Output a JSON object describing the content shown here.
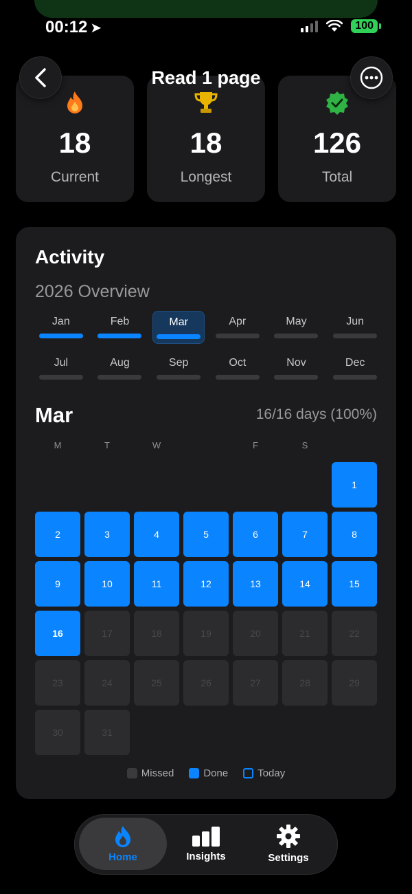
{
  "status_bar": {
    "time": "00:12",
    "battery": "100"
  },
  "header": {
    "title": "Read 1 page"
  },
  "stats": [
    {
      "value": "18",
      "label": "Current",
      "icon": "flame-icon"
    },
    {
      "value": "18",
      "label": "Longest",
      "icon": "trophy-icon"
    },
    {
      "value": "126",
      "label": "Total",
      "icon": "check-badge-icon"
    }
  ],
  "activity": {
    "title": "Activity",
    "subtitle": "2026 Overview",
    "months": [
      "Jan",
      "Feb",
      "Mar",
      "Apr",
      "May",
      "Jun",
      "Jul",
      "Aug",
      "Sep",
      "Oct",
      "Nov",
      "Dec"
    ],
    "selected_month": "Mar",
    "calendar": {
      "month": "Mar",
      "summary": "16/16 days (100%)",
      "weekdays": [
        "M",
        "T",
        "W",
        "",
        "F",
        "S",
        ""
      ],
      "days": [
        "1",
        "2",
        "3",
        "4",
        "5",
        "6",
        "7",
        "8",
        "9",
        "10",
        "11",
        "12",
        "13",
        "14",
        "15",
        "16",
        "17",
        "18",
        "19",
        "20",
        "21",
        "22",
        "23",
        "24",
        "25",
        "26",
        "27",
        "28",
        "29",
        "30",
        "31"
      ],
      "today": "16"
    },
    "legend": {
      "missed": "Missed",
      "done": "Done",
      "today": "Today"
    }
  },
  "tabs": {
    "home": "Home",
    "insights": "Insights",
    "settings": "Settings"
  },
  "colors": {
    "accent": "#0a84ff",
    "card": "#1c1c1e",
    "missed": "#2c2c2e",
    "battery": "#30d158"
  }
}
